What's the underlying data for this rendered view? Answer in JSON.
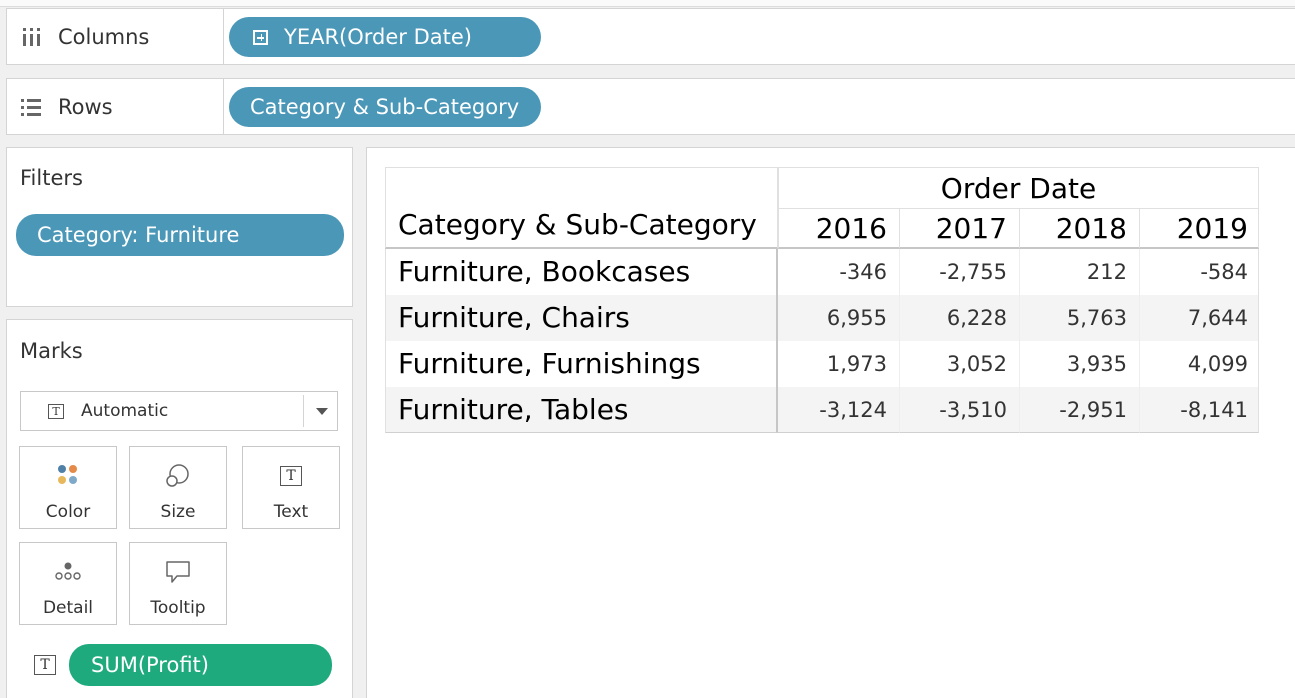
{
  "shelves": {
    "columns": {
      "label": "Columns",
      "pill": "YEAR(Order Date)"
    },
    "rows": {
      "label": "Rows",
      "pill": "Category & Sub-Category"
    }
  },
  "filters": {
    "title": "Filters",
    "pill": "Category: Furniture"
  },
  "marks": {
    "title": "Marks",
    "type_select": "Automatic",
    "buttons": {
      "color": "Color",
      "size": "Size",
      "text": "Text",
      "detail": "Detail",
      "tooltip": "Tooltip"
    },
    "field_pill": "SUM(Profit)",
    "field_pill_color": "#1eaa7c",
    "icon_names": [
      "color-dots-icon",
      "size-circles-icon",
      "text-t-icon",
      "detail-dots-icon",
      "tooltip-bubble-icon"
    ]
  },
  "colors": {
    "dimension_pill": "#4a97b8",
    "measure_pill": "#1eaa7c"
  },
  "table": {
    "column_group_header": "Order Date",
    "row_header": "Category & Sub-Category",
    "years": [
      "2016",
      "2017",
      "2018",
      "2019"
    ],
    "rows": [
      {
        "label": "Furniture, Bookcases",
        "values": [
          "-346",
          "-2,755",
          "212",
          "-584"
        ]
      },
      {
        "label": "Furniture, Chairs",
        "values": [
          "6,955",
          "6,228",
          "5,763",
          "7,644"
        ]
      },
      {
        "label": "Furniture, Furnishings",
        "values": [
          "1,973",
          "3,052",
          "3,935",
          "4,099"
        ]
      },
      {
        "label": "Furniture, Tables",
        "values": [
          "-3,124",
          "-3,510",
          "-2,951",
          "-8,141"
        ]
      }
    ]
  }
}
